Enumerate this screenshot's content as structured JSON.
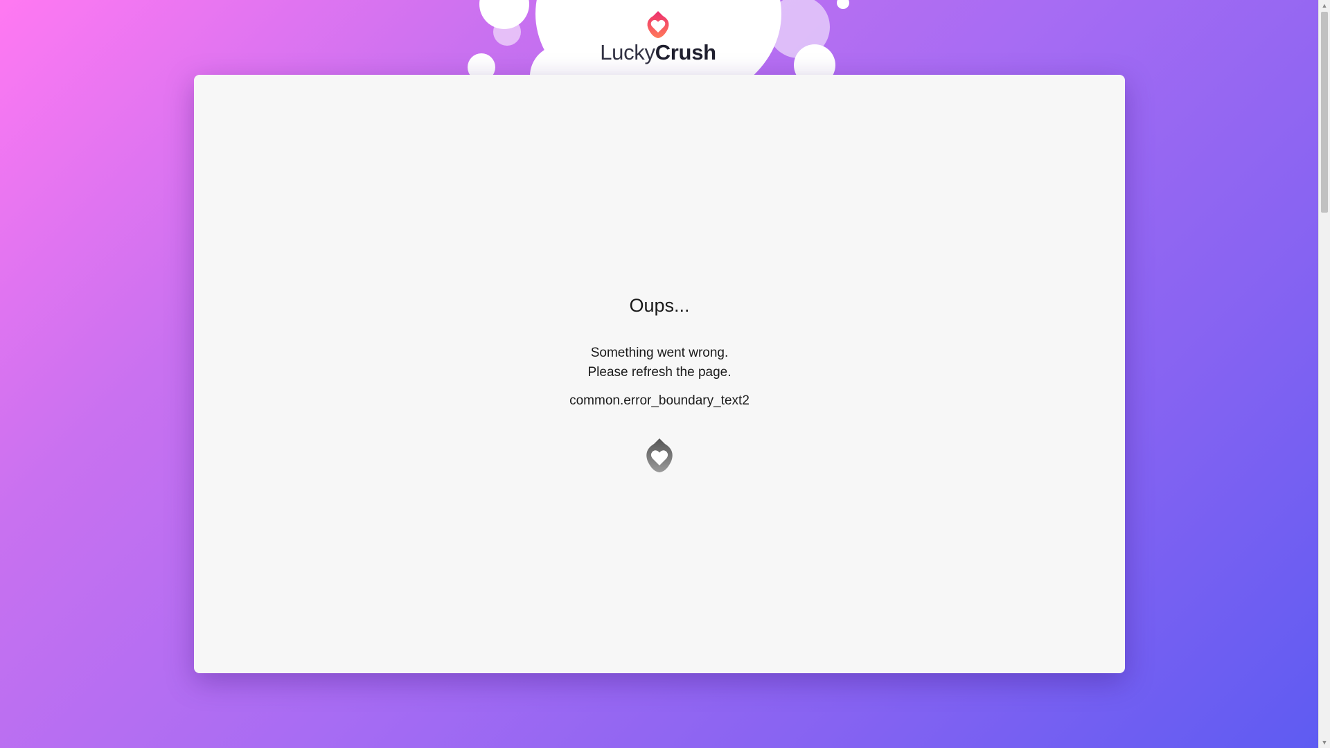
{
  "brand": {
    "name_light": "Lucky",
    "name_bold": "Crush",
    "logo_icon": "heart-flame-logo-icon",
    "logo_colors": [
      "#f0337a",
      "#ff6e5c",
      "#ffffff"
    ]
  },
  "error": {
    "title": "Oups...",
    "line1": "Something went wrong.",
    "line2": "Please refresh the page.",
    "key_text": "common.error_boundary_text2",
    "footer_icon": "heart-flame-gray-icon"
  },
  "colors": {
    "bg_start": "#ff79f2",
    "bg_end": "#5d5bf2",
    "card": "#f7f7f7"
  }
}
